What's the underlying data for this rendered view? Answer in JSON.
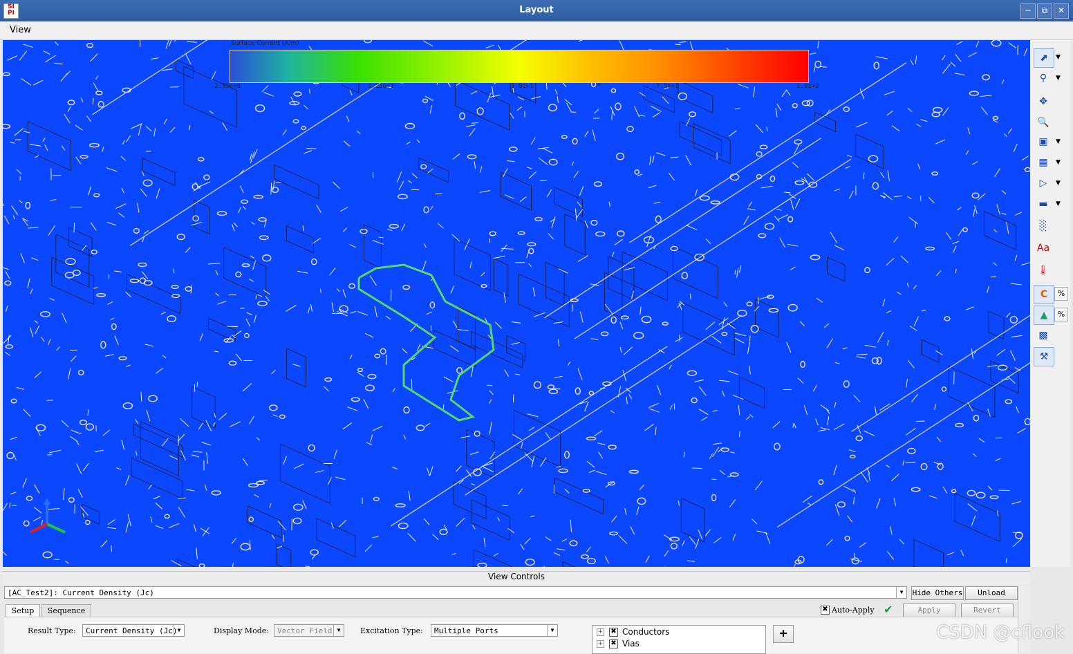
{
  "window": {
    "title": "Layout",
    "app_icon": "SI PI"
  },
  "menubar": {
    "items": [
      "View"
    ]
  },
  "colorbar": {
    "title": "Surface Current (A/m)",
    "labels": [
      "2.35e+0",
      "1.25e+1",
      "5.0e+1",
      "7.5e+1",
      "1.0e+2"
    ],
    "colors": [
      "#2a4fd9",
      "#38e000",
      "#f4ff00",
      "#ff8a00",
      "#ff0000"
    ]
  },
  "canvas": {
    "background": "#0a47ff",
    "accent": "#59d66a"
  },
  "toolbar": {
    "icons": [
      "select-arrow-icon",
      "zoom-area-icon",
      "pan-icon",
      "zoom-icon",
      "view-box-icon",
      "3d-box-icon",
      "play-icon",
      "layer-icon",
      "histogram-icon",
      "text-label-icon",
      "thermometer-icon",
      "color-map-icon",
      "surface-map-icon",
      "capture-icon",
      "probe-icon"
    ],
    "pct_label": "%"
  },
  "view_controls": {
    "header": "View Controls",
    "result_name": "[AC_Test2]: Current Density (Jc)",
    "hide_others": "Hide Others",
    "unload": "Unload",
    "tabs": [
      "Setup",
      "Sequence"
    ],
    "auto_apply_label": "Auto-Apply",
    "apply": "Apply",
    "revert": "Revert",
    "result_type_label": "Result Type:",
    "result_type_value": "Current Density (Jc)",
    "display_mode_label": "Display Mode:",
    "display_mode_value": "Vector Field",
    "excitation_type_label": "Excitation Type:",
    "excitation_type_value": "Multiple Ports",
    "tree": [
      "Conductors",
      "Vias"
    ]
  },
  "watermark": "CSDN @cflook"
}
